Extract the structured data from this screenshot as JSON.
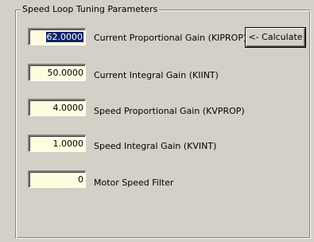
{
  "group": {
    "title": "Speed Loop Tuning Parameters"
  },
  "rows": [
    {
      "value": "62.0000",
      "label": "Current Proportional Gain (KIPROP)"
    },
    {
      "value": "50.0000",
      "label": "Current Integral Gain (KIINT)"
    },
    {
      "value": "4.0000",
      "label": "Speed Proportional Gain (KVPROP)"
    },
    {
      "value": "1.0000",
      "label": "Speed Integral Gain (KVINT)"
    },
    {
      "value": "0",
      "label": "Motor Speed Filter"
    }
  ],
  "calculate_button": {
    "label": "<- Calculate"
  },
  "colors": {
    "dialog_background": "#d4d0c8",
    "field_background": "#fefde0",
    "selection": "#0a246a"
  }
}
